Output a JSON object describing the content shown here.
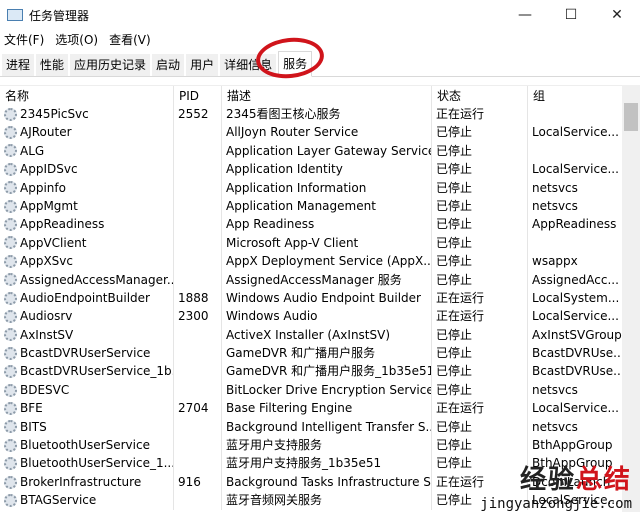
{
  "window": {
    "title": "任务管理器",
    "minimize": "—",
    "maximize": "☐",
    "close": "✕"
  },
  "menu": [
    "文件(F)",
    "选项(O)",
    "查看(V)"
  ],
  "tabs": [
    "进程",
    "性能",
    "应用历史记录",
    "启动",
    "用户",
    "详细信息",
    "服务"
  ],
  "columns": [
    "名称",
    "PID",
    "描述",
    "状态",
    "组"
  ],
  "rows": [
    [
      "2345PicSvc",
      "2552",
      "2345看图王核心服务",
      "正在运行",
      ""
    ],
    [
      "AJRouter",
      "",
      "AllJoyn Router Service",
      "已停止",
      "LocalService..."
    ],
    [
      "ALG",
      "",
      "Application Layer Gateway Service",
      "已停止",
      ""
    ],
    [
      "AppIDSvc",
      "",
      "Application Identity",
      "已停止",
      "LocalService..."
    ],
    [
      "Appinfo",
      "",
      "Application Information",
      "已停止",
      "netsvcs"
    ],
    [
      "AppMgmt",
      "",
      "Application Management",
      "已停止",
      "netsvcs"
    ],
    [
      "AppReadiness",
      "",
      "App Readiness",
      "已停止",
      "AppReadiness"
    ],
    [
      "AppVClient",
      "",
      "Microsoft App-V Client",
      "已停止",
      ""
    ],
    [
      "AppXSvc",
      "",
      "AppX Deployment Service (AppX...",
      "已停止",
      "wsappx"
    ],
    [
      "AssignedAccessManager...",
      "",
      "AssignedAccessManager 服务",
      "已停止",
      "AssignedAcc..."
    ],
    [
      "AudioEndpointBuilder",
      "1888",
      "Windows Audio Endpoint Builder",
      "正在运行",
      "LocalSystem..."
    ],
    [
      "Audiosrv",
      "2300",
      "Windows Audio",
      "正在运行",
      "LocalService..."
    ],
    [
      "AxInstSV",
      "",
      "ActiveX Installer (AxInstSV)",
      "已停止",
      "AxInstSVGroup"
    ],
    [
      "BcastDVRUserService",
      "",
      "GameDVR 和广播用户服务",
      "已停止",
      "BcastDVRUse..."
    ],
    [
      "BcastDVRUserService_1b...",
      "",
      "GameDVR 和广播用户服务_1b35e51",
      "已停止",
      "BcastDVRUse..."
    ],
    [
      "BDESVC",
      "",
      "BitLocker Drive Encryption Service",
      "已停止",
      "netsvcs"
    ],
    [
      "BFE",
      "2704",
      "Base Filtering Engine",
      "正在运行",
      "LocalService..."
    ],
    [
      "BITS",
      "",
      "Background Intelligent Transfer S...",
      "已停止",
      "netsvcs"
    ],
    [
      "BluetoothUserService",
      "",
      "蓝牙用户支持服务",
      "已停止",
      "BthAppGroup"
    ],
    [
      "BluetoothUserService_1...",
      "",
      "蓝牙用户支持服务_1b35e51",
      "已停止",
      "BthAppGroup"
    ],
    [
      "BrokerInfrastructure",
      "916",
      "Background Tasks Infrastructure S...",
      "正在运行",
      "DcomLaunch"
    ],
    [
      "BTAGService",
      "",
      "蓝牙音频网关服务",
      "已停止",
      "LocalService..."
    ]
  ],
  "watermark": {
    "line1a": "经验",
    "line1b": "总结",
    "line2": "jingyanzongjie.com"
  }
}
